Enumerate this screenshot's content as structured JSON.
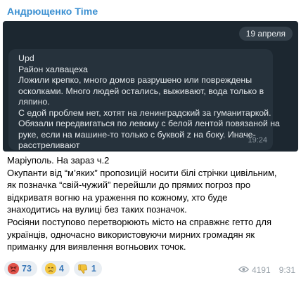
{
  "channel": {
    "title": "Андрющенко Time"
  },
  "media": {
    "date": "19 апреля",
    "lines": [
      "Upd",
      "Район халвацеха",
      "Ложили крепко, много домов разрушено или повреждены",
      "осколками.  Много людей остались, выживают, вода только в",
      "ляпино.",
      "С едой проблем нет, хотят на ленинградский за гуманитаркой.",
      "Обязали передвигаться по левому с белой лентой повязаной на",
      "руке, если на машине-то только с буквой z на боку. Иначе-",
      "расстреливают"
    ],
    "time": "19:24"
  },
  "post": {
    "lines": [
      "Маріуполь. На зараз ч.2",
      "Окупанти від “м’яких” пропозицій носити білі стрічки цивільним,",
      "як позначка “свій-чужий” перейшли до прямих погроз про",
      "відкриватя вогню на ураження по кожному, хто буде",
      "знаходитись на вулиці без таких позначок.",
      "Росіяни поступово перетворюють місто на справжнє гетто для",
      "українців, одночасно використовуючи мирних громадян як",
      "приманку для виявлення вогньових точок."
    ]
  },
  "reactions": [
    {
      "icon": "angry-face-icon",
      "count": "73"
    },
    {
      "icon": "crying-face-icon",
      "count": "4"
    },
    {
      "icon": "thumbs-down-icon",
      "count": "1"
    }
  ],
  "meta": {
    "views": "4191",
    "time": "9:31"
  }
}
